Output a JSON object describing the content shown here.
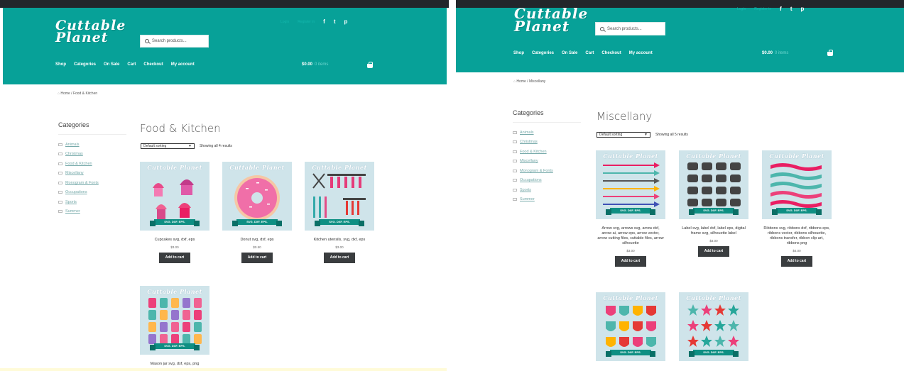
{
  "site": {
    "logo_line1": "Cuttable",
    "logo_line2": "Planet",
    "search_placeholder": "Search products...",
    "top_links": [
      "Login",
      "Register in"
    ],
    "social": [
      {
        "name": "facebook-icon",
        "glyph": "f"
      },
      {
        "name": "twitter-icon",
        "glyph": "t"
      },
      {
        "name": "pinterest-icon",
        "glyph": "p"
      }
    ],
    "nav": [
      "Shop",
      "Categories",
      "On Sale",
      "Cart",
      "Checkout",
      "My account"
    ],
    "cart_total": "$0.00",
    "cart_items": "0 items",
    "brand_color": "#07a198",
    "sidebar_title": "Categories",
    "categories": [
      "Animals",
      "Christmas",
      "Food & Kitchen",
      "Miscellany",
      "Monogram & Fonts",
      "Occupations",
      "Sports",
      "Summer"
    ],
    "sort_label": "Default sorting",
    "add_to_cart": "Add to cart",
    "image_brand": "Cuttable Planet",
    "image_ribbon": "SVG. DXF. EPS."
  },
  "pageA": {
    "crumb_home": "Home",
    "crumb_current": "Food & Kitchen",
    "title": "Food & Kitchen",
    "result_count": "Showing all 4 results",
    "products": [
      {
        "name": "Cupcakes svg, dxf, eps",
        "price": "$3.00",
        "art": "cupcakes"
      },
      {
        "name": "Donut svg, dxf, eps",
        "price": "$0.50",
        "art": "donut"
      },
      {
        "name": "Kitchen utensils, svg, dxf, eps",
        "price": "$3.00",
        "art": "utensils"
      },
      {
        "name": "Mason jar svg, dxf, eps, png",
        "price": "",
        "art": "jars"
      }
    ]
  },
  "pageB": {
    "crumb_home": "Home",
    "crumb_current": "Miscellany",
    "title": "Miscellany",
    "result_count": "Showing all 5 results",
    "products": [
      {
        "name": "Arrow svg, arrows svg, arrow dxf, arrow ai, arrow eps, arrow vector, arrow cutting files, cuttable files, arrow silhouette",
        "price": "$3.00",
        "art": "arrows"
      },
      {
        "name": "Label svg, label dxf, label eps, digital frame svg, silhouette label",
        "price": "$3.00",
        "art": "labels"
      },
      {
        "name": "Ribbons svg, ribbons dxf, ribbons eps, ribbons vector, ribbons silhouette, ribbons transfer, ribbon clip art, ribbons png",
        "price": "$4.00",
        "art": "ribbons"
      },
      {
        "name": "",
        "price": "",
        "art": "shields"
      },
      {
        "name": "",
        "price": "",
        "art": "stars"
      }
    ]
  }
}
